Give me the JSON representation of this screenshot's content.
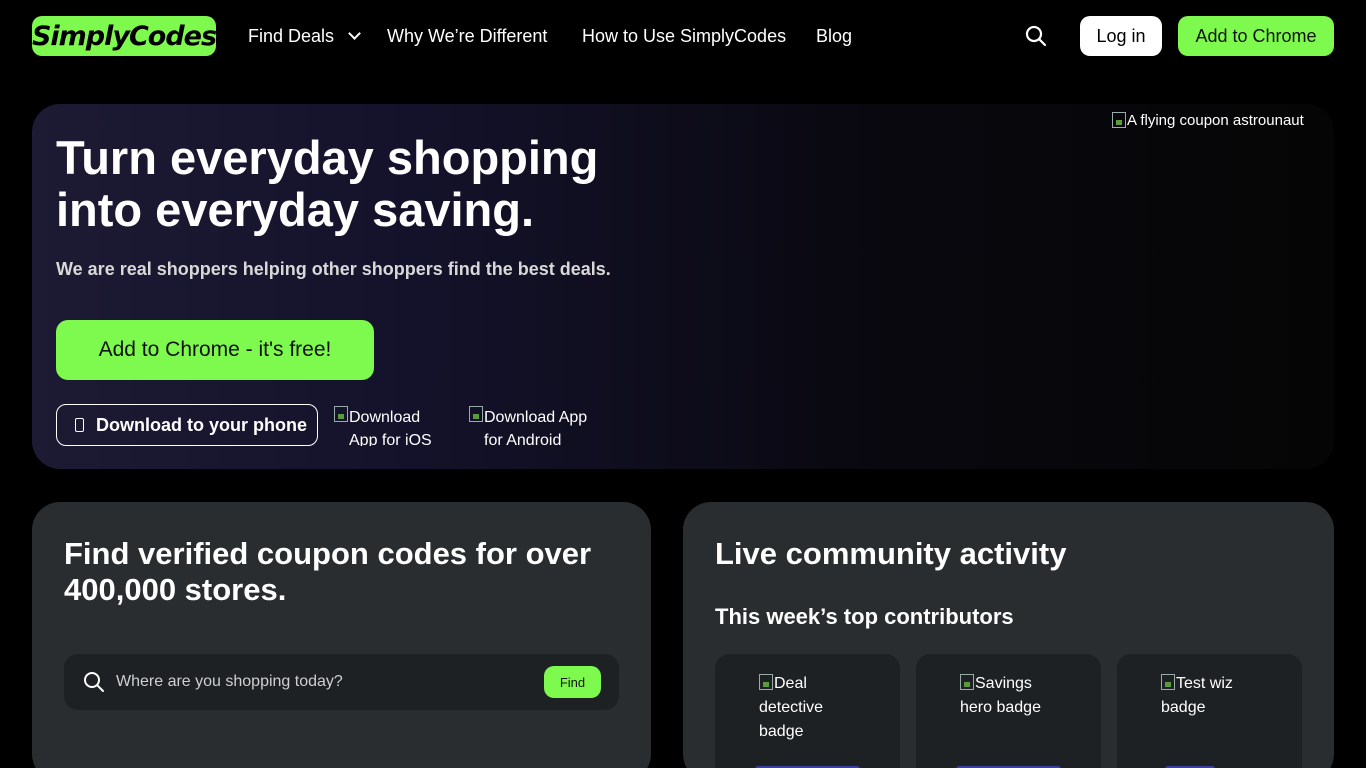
{
  "nav": {
    "logo": "SimplyCodes",
    "find_deals": "Find Deals",
    "why_different": "Why We’re Different",
    "how_to_use": "How to Use SimplyCodes",
    "blog": "Blog",
    "login": "Log in",
    "add_to_chrome": "Add to Chrome"
  },
  "hero": {
    "title": "Turn everyday shopping into everyday saving.",
    "subtitle": "We are real shoppers helping other shoppers find the best deals.",
    "cta": "Add to Chrome - it's free!",
    "phone_button": "Download to your phone",
    "ios_alt": "Download App for iOS",
    "android_alt": "Download App for Android",
    "astronaut_alt": "A flying coupon astrounaut"
  },
  "coupon_card": {
    "title": "Find verified coupon codes for over 400,000 stores.",
    "search_placeholder": "Where are you shopping today?",
    "find_button": "Find"
  },
  "community_card": {
    "title": "Live community activity",
    "contributors_title": "This week’s top contributors",
    "badges": [
      {
        "alt": "Deal detective badge"
      },
      {
        "alt": "Savings hero badge"
      },
      {
        "alt": "Test wiz badge"
      }
    ]
  },
  "colors": {
    "accent_green": "#7ef94d",
    "card_bg": "#2a2d30",
    "page_bg": "#000000"
  }
}
